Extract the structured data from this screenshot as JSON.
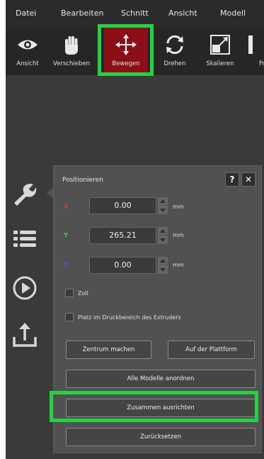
{
  "menu": [
    "Datei",
    "Bearbeiten",
    "Schnitt",
    "Ansicht",
    "Modell"
  ],
  "toolbar": [
    {
      "label": "Ansicht",
      "icon": "eye-icon"
    },
    {
      "label": "Verschieben",
      "icon": "hand-icon"
    },
    {
      "label": "Bewegen",
      "icon": "move-arrows-icon",
      "active": true
    },
    {
      "label": "Drehen",
      "icon": "rotate-icon"
    },
    {
      "label": "Skalieren",
      "icon": "scale-icon"
    },
    {
      "label": "Fr",
      "icon": "cut-icon"
    }
  ],
  "side_icons": [
    "wrench-icon",
    "list-icon",
    "play-icon",
    "upload-icon"
  ],
  "panel": {
    "title": "Positionieren",
    "help_label": "?",
    "close_label": "✕",
    "fields": [
      {
        "axis": "X",
        "value": "0.00",
        "unit": "mm",
        "color": "#d83a3a"
      },
      {
        "axis": "Y",
        "value": "265.21",
        "unit": "mm",
        "color": "#3fd23f"
      },
      {
        "axis": "Z",
        "value": "0.00",
        "unit": "mm",
        "color": "#4455ee"
      }
    ],
    "checkboxes": [
      {
        "label": "Zoll",
        "checked": false
      },
      {
        "label": "Platz im Druckbereich des Extruders",
        "checked": false
      }
    ],
    "buttons": {
      "center": "Zentrum machen",
      "platform": "Auf der Plattform",
      "arrange": "Alle Modelle anordnen",
      "align": "Zusammen ausrichten",
      "reset": "Zurücksetzen"
    }
  },
  "colors": {
    "highlight": "#27d042",
    "active_tool": "#8b0f19"
  }
}
